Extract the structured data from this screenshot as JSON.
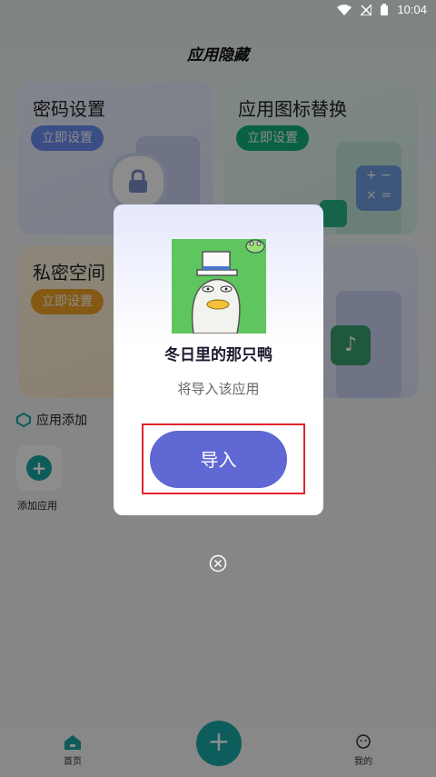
{
  "status_bar": {
    "time": "10:04"
  },
  "header": {
    "title": "应用隐藏"
  },
  "cards": {
    "password": {
      "title": "密码设置",
      "button": "立即设置"
    },
    "icon_replace": {
      "title": "应用图标替换",
      "button": "立即设置"
    },
    "private_space": {
      "title": "私密空间",
      "button": "立即设置"
    }
  },
  "app_add": {
    "section_label": "应用添加",
    "add_label": "添加应用"
  },
  "bottom_nav": {
    "home": "首页",
    "mine": "我的",
    "fab": "+"
  },
  "dialog": {
    "app_name": "冬日里的那只鸭",
    "description": "将导入该应用",
    "import_button": "导入"
  },
  "colors": {
    "accent": "#1ba9a9",
    "import": "#6068d3",
    "highlight": "#e0242e"
  }
}
